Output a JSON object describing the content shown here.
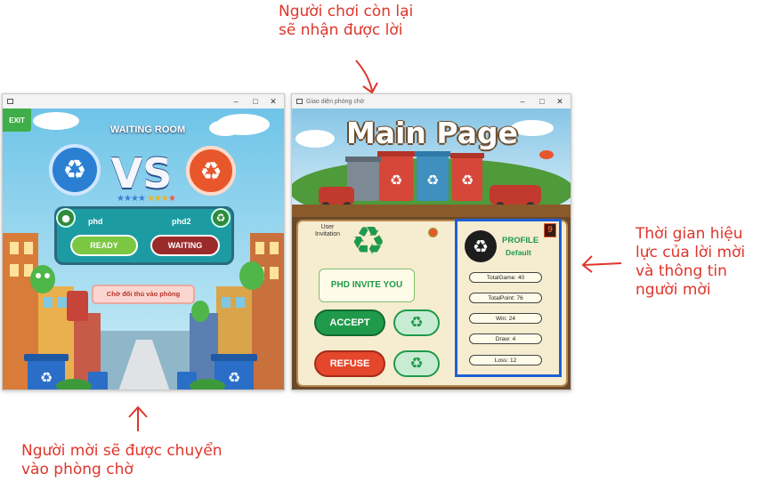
{
  "annotations": {
    "top_line1": "Người chơi còn lại",
    "top_line2": "sẽ nhận được lời",
    "right_line1": "Thời gian hiệu",
    "right_line2": "lực của lời mời",
    "right_line3": "và thông tin",
    "right_line4": "người mời",
    "bottom_line1": "Người mời sẽ được chuyển",
    "bottom_line2": "vào phòng chờ"
  },
  "waiting_window": {
    "title": "",
    "exit_label": "EXIT",
    "heading": "WAITING ROOM",
    "vs_label": "VS",
    "player1_name": "phd",
    "player2_name": "phd2",
    "ready_label": "READY",
    "waiting_label": "WAITING",
    "waiting_message": "Chờ đối thủ vào phòng"
  },
  "main_window": {
    "title": "Giao diện phòng chờ",
    "heading": "Main Page",
    "user_invitation_label": "User Invitation",
    "invite_message": "PHD INVITE YOU",
    "accept_label": "ACCEPT",
    "refuse_label": "REFUSE",
    "profile_label": "PROFILE",
    "profile_name": "Default",
    "countdown": "9",
    "stats": {
      "total_game": "TotalGame: 40",
      "total_point": "TotalPoint: 76",
      "win": "Win: 24",
      "draw": "Draw: 4",
      "loss": "Loss: 12"
    }
  },
  "colors": {
    "annotation": "#e0352b",
    "highlight_box": "#1f5fd6",
    "ready_green": "#7bc742",
    "waiting_red": "#9b2a2a",
    "accept_green": "#1f9a4a",
    "refuse_red": "#e4472c",
    "panel_cream": "#f6ecd0"
  },
  "icons": [
    "recycle-icon",
    "minimize-icon",
    "maximize-icon",
    "close-icon",
    "red-arrow-icon"
  ]
}
